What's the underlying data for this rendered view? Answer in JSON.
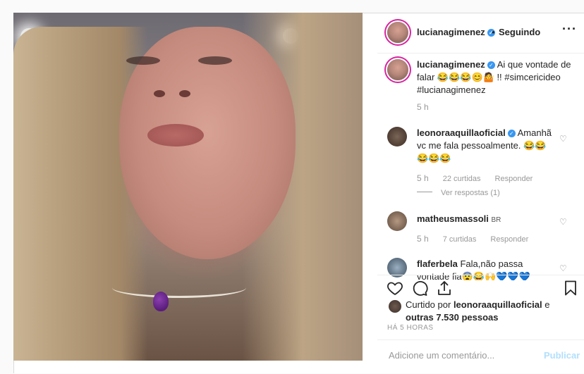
{
  "header": {
    "username": "lucianagimenez",
    "verified_icon": "verified-icon",
    "separator": "•",
    "follow_status": "Seguindo",
    "more_icon": "more-options-icon"
  },
  "caption": {
    "username": "lucianagimenez",
    "text": "Ai que vontade de falar 😂😂😂😊🤷 !! #simcericideo #lucianagimenez",
    "time": "5 h"
  },
  "comments": [
    {
      "username": "leonoraaquillaoficial",
      "verified": true,
      "text": "Amanhã vc me fala pessoalmente. 😂😂 😂😂😂",
      "time": "5 h",
      "likes": "22 curtidas",
      "reply": "Responder",
      "view_replies": "Ver respostas (1)"
    },
    {
      "username": "matheusmassoli",
      "suffix": "BR",
      "text": "",
      "time": "5 h",
      "likes": "7 curtidas",
      "reply": "Responder"
    },
    {
      "username": "flaferbela",
      "text": "Fala,não passa vontade fia😨😂🙌💙💙💙",
      "time": "",
      "likes": "",
      "reply": ""
    }
  ],
  "actions": {
    "like": "heart-icon",
    "comment": "comment-icon",
    "share": "share-icon",
    "save": "bookmark-icon"
  },
  "liked_by": {
    "prefix": "Curtido por",
    "user": "leonoraaquillaoficial",
    "connector": "e",
    "others": "outras 7.530 pessoas"
  },
  "timestamp": "HÁ 5 HORAS",
  "add_comment": {
    "placeholder": "Adicione um comentário...",
    "publish": "Publicar"
  },
  "colors": {
    "link": "#003569",
    "verified": "#3897f0",
    "story_ring": "#d6249f",
    "publish_disabled": "#b2dffc"
  }
}
